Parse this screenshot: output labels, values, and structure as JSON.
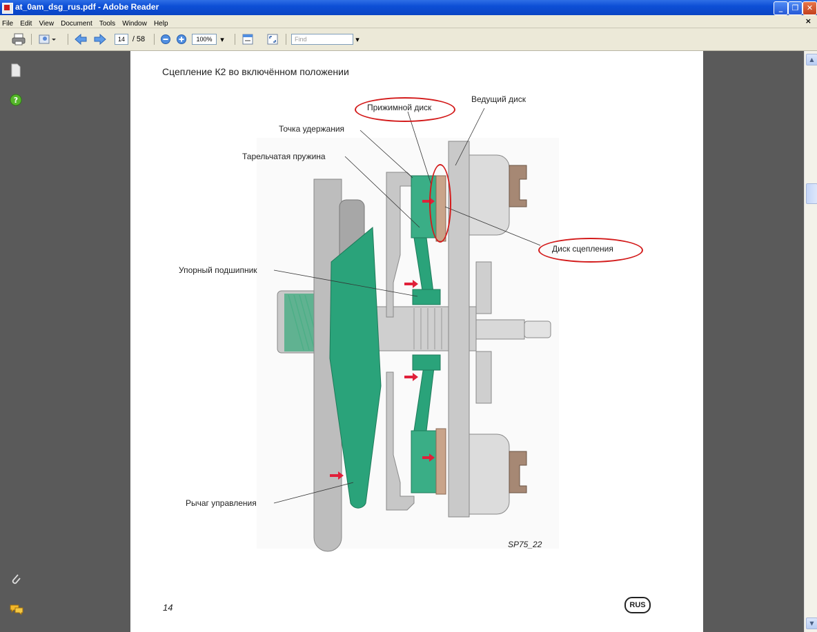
{
  "window": {
    "title": "at_0am_dsg_rus.pdf - Adobe Reader"
  },
  "menu": [
    "File",
    "Edit",
    "View",
    "Document",
    "Tools",
    "Window",
    "Help"
  ],
  "menu_close": "×",
  "toolbar": {
    "page_current": "14",
    "page_total": "/ 58",
    "zoom": "100%",
    "find_placeholder": "Find"
  },
  "page": {
    "title": "Сцепление К2 во включённом положении",
    "labels": {
      "pressure_disc": "Прижимной диск",
      "drive_disc": "Ведущий диск",
      "hold_point": "Точка удержания",
      "diaphragm_spring": "Тарельчатая пружина",
      "clutch_disc": "Диск сцепления",
      "release_bearing": "Упорный подшипник",
      "control_lever": "Рычаг управления"
    },
    "figure_id": "SP75_22",
    "page_number": "14",
    "lang_badge": "RUS"
  },
  "colors": {
    "highlight_red": "#d31b1b",
    "part_green": "#2aa37a",
    "part_gray": "#b9b9b9",
    "arrow_red": "#e0203a"
  }
}
